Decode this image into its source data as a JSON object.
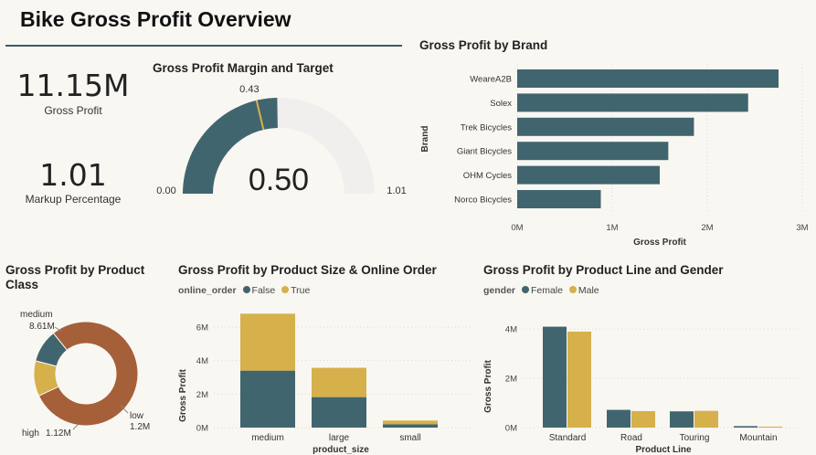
{
  "header": {
    "title": "Bike Gross Profit Overview"
  },
  "kpis": {
    "gross_profit": {
      "value": "11.15M",
      "label": "Gross Profit"
    },
    "markup": {
      "value": "1.01",
      "label": "Markup Percentage"
    }
  },
  "colors": {
    "teal": "#41656e",
    "gold": "#d6b04a",
    "brown": "#a5603a",
    "gauge_bg": "#f0efee",
    "target": "#d6b04a"
  },
  "chart_data": [
    {
      "id": "gauge",
      "type": "gauge",
      "title": "Gross Profit Margin and Target",
      "value": 0.5,
      "value_label": "0.50",
      "min": 0.0,
      "min_label": "0.00",
      "max": 1.01,
      "max_label": "1.01",
      "target": 0.43,
      "target_label": "0.43"
    },
    {
      "id": "brand",
      "type": "bar",
      "orientation": "horizontal",
      "title": "Gross Profit by Brand",
      "xlabel": "Gross Profit",
      "ylabel": "Brand",
      "categories": [
        "WeareA2B",
        "Solex",
        "Trek Bicycles",
        "Giant Bicycles",
        "OHM Cycles",
        "Norco Bicycles"
      ],
      "values": [
        2.75,
        2.43,
        1.86,
        1.59,
        1.5,
        0.88
      ],
      "xlim": [
        0,
        3
      ],
      "xticks": [
        0,
        1,
        2,
        3
      ],
      "xtick_labels": [
        "0M",
        "1M",
        "2M",
        "3M"
      ]
    },
    {
      "id": "class",
      "type": "pie",
      "donut": true,
      "title": "Gross Profit by Product Class",
      "slices": [
        {
          "name": "medium",
          "value": 8.61,
          "value_label": "8.61M"
        },
        {
          "name": "low",
          "value": 1.2,
          "value_label": "1.2M"
        },
        {
          "name": "high",
          "value": 1.12,
          "value_label": "1.12M"
        }
      ]
    },
    {
      "id": "size",
      "type": "bar",
      "stacked": true,
      "title": "Gross Profit by Product Size & Online Order",
      "legend_title": "online_order",
      "xlabel": "product_size",
      "ylabel": "Gross Profit",
      "categories": [
        "medium",
        "large",
        "small"
      ],
      "series": [
        {
          "name": "False",
          "values": [
            3.4,
            1.82,
            0.2
          ]
        },
        {
          "name": "True",
          "values": [
            3.4,
            1.75,
            0.22
          ]
        }
      ],
      "ylim": [
        0,
        7.2
      ],
      "yticks": [
        0,
        2,
        4,
        6
      ],
      "ytick_labels": [
        "0M",
        "2M",
        "4M",
        "6M"
      ]
    },
    {
      "id": "line",
      "type": "bar",
      "grouped": true,
      "title": "Gross Profit by Product Line and Gender",
      "legend_title": "gender",
      "xlabel": "Product Line",
      "ylabel": "Gross Profit",
      "categories": [
        "Standard",
        "Road",
        "Touring",
        "Mountain"
      ],
      "series": [
        {
          "name": "Female",
          "values": [
            4.1,
            0.72,
            0.66,
            0.06
          ]
        },
        {
          "name": "Male",
          "values": [
            3.9,
            0.67,
            0.68,
            0.04
          ]
        }
      ],
      "ylim": [
        0,
        4.9
      ],
      "yticks": [
        0,
        2,
        4
      ],
      "ytick_labels": [
        "0M",
        "2M",
        "4M"
      ]
    }
  ]
}
